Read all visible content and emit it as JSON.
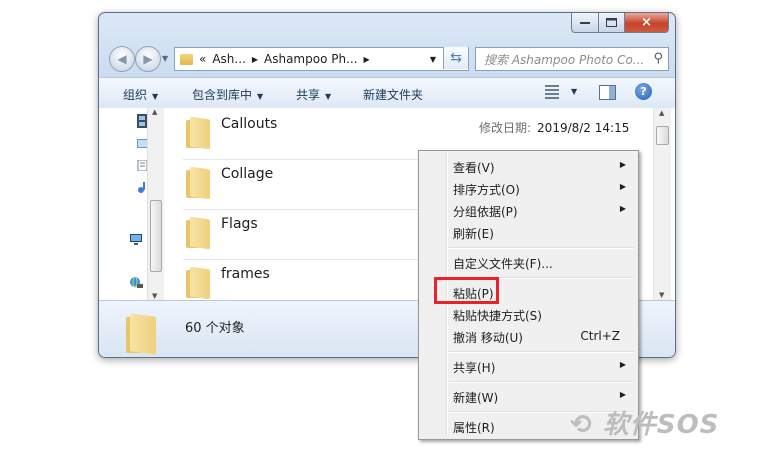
{
  "window": {
    "close_glyph": "×"
  },
  "nav": {
    "address_parts": [
      "«",
      "Ash...",
      "Ashampoo Ph..."
    ],
    "search_placeholder": "搜索 Ashampoo Photo Co..."
  },
  "toolbar": {
    "organize": "组织",
    "include_in_library": "包含到库中",
    "share": "共享",
    "new_folder": "新建文件夹"
  },
  "files": [
    {
      "name": "Callouts",
      "date_label": "修改日期:",
      "date": "2019/8/2 14:15"
    },
    {
      "name": "Collage"
    },
    {
      "name": "Flags"
    },
    {
      "name": "frames"
    }
  ],
  "details": {
    "count_text": "60 个对象"
  },
  "context_menu": {
    "items": [
      {
        "label": "查看(V)",
        "submenu": true
      },
      {
        "label": "排序方式(O)",
        "submenu": true
      },
      {
        "label": "分组依据(P)",
        "submenu": true
      },
      {
        "label": "刷新(E)"
      },
      {
        "label": "自定义文件夹(F)..."
      },
      {
        "label": "粘贴(P)"
      },
      {
        "label": "粘贴快捷方式(S)"
      },
      {
        "label": "撤消 移动(U)",
        "shortcut": "Ctrl+Z"
      },
      {
        "label": "共享(H)",
        "submenu": true
      },
      {
        "label": "新建(W)",
        "submenu": true
      },
      {
        "label": "属性(R)"
      }
    ],
    "highlighted_item": "粘贴(P)",
    "highlight_color": "#e8212b"
  },
  "watermark": "软件SOS",
  "icons": [
    "back-arrow-icon",
    "forward-arrow-icon",
    "folder-icon",
    "refresh-icon",
    "search-icon",
    "view-options-icon",
    "preview-pane-icon",
    "help-icon",
    "chevron-right-icon"
  ]
}
